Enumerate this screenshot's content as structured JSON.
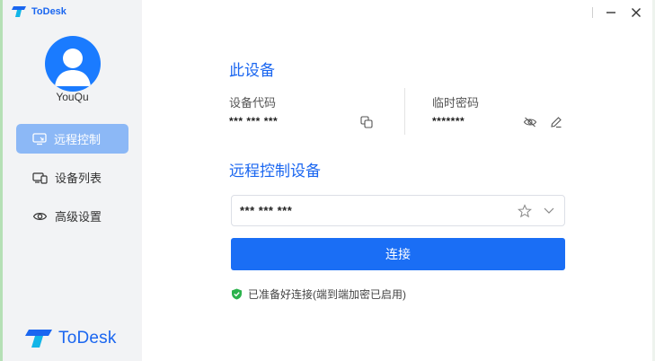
{
  "app": {
    "title": "ToDesk",
    "brand": "ToDesk"
  },
  "user": {
    "name": "YouQu"
  },
  "sidebar": {
    "items": [
      {
        "label": "远程控制",
        "icon": "remote-control-icon",
        "active": true
      },
      {
        "label": "设备列表",
        "icon": "device-list-icon",
        "active": false
      },
      {
        "label": "高级设置",
        "icon": "settings-eye-icon",
        "active": false
      }
    ]
  },
  "window_controls": {
    "minimize": "–",
    "close": "×"
  },
  "this_device": {
    "title": "此设备",
    "code_label": "设备代码",
    "code_value": "*** *** ***",
    "temp_label": "临时密码",
    "temp_value": "*******"
  },
  "remote": {
    "title": "远程控制设备",
    "input_value": "*** *** ***",
    "connect_label": "连接",
    "status_text": "已准备好连接(端到端加密已启用)"
  },
  "colors": {
    "accent": "#1a6ef5",
    "sidebar_active": "#8cb8f6",
    "status_ok": "#2bb24c"
  }
}
